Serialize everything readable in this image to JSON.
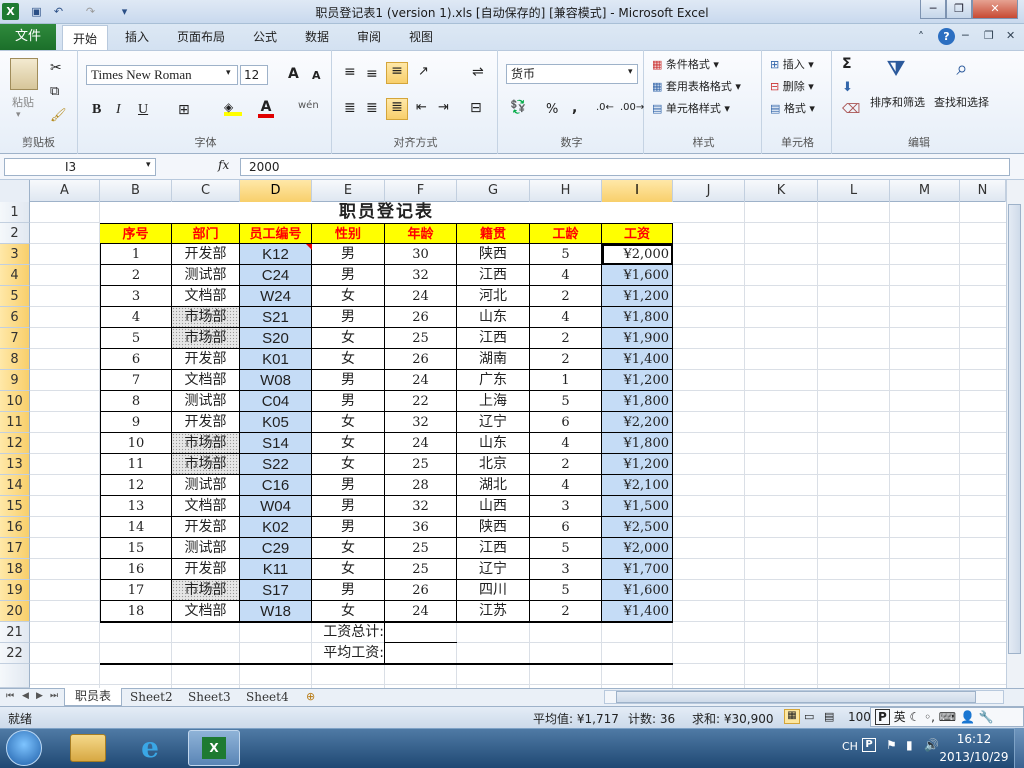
{
  "window": {
    "title": "职员登记表1 (version 1).xls [自动保存的] [兼容模式] - Microsoft Excel",
    "help_icon": "?",
    "app_icon": "X"
  },
  "ribbon_tabs": [
    "文件",
    "开始",
    "插入",
    "页面布局",
    "公式",
    "数据",
    "审阅",
    "视图"
  ],
  "ribbon": {
    "clipboard": {
      "paste": "粘贴",
      "label": "剪贴板"
    },
    "font": {
      "name": "Times New Roman",
      "size": "12",
      "label": "字体",
      "bold": "B",
      "italic": "I",
      "underline": "U",
      "grow": "A",
      "shrink": "A",
      "color_a": "A",
      "wen": "wén"
    },
    "align": {
      "label": "对齐方式"
    },
    "number": {
      "format": "货币",
      "percent": "%",
      "comma": ",",
      "label": "数字"
    },
    "styles": {
      "cond": "条件格式",
      "table": "套用表格格式",
      "cell": "单元格样式",
      "label": "样式"
    },
    "cells": {
      "insert": "插入",
      "delete": "删除",
      "format": "格式",
      "label": "单元格"
    },
    "edit": {
      "sum": "Σ",
      "sort": "排序和筛选",
      "find": "查找和选择",
      "label": "编辑"
    }
  },
  "formula_bar": {
    "name_box": "I3",
    "fx": "fx",
    "value": "2000"
  },
  "columns": [
    "A",
    "B",
    "C",
    "D",
    "E",
    "F",
    "G",
    "H",
    "I",
    "J",
    "K",
    "L",
    "M",
    "N"
  ],
  "sheet_title": "职员登记表",
  "headers": [
    "序号",
    "部门",
    "员工编号",
    "性别",
    "年龄",
    "籍贯",
    "工龄",
    "工资"
  ],
  "rows": [
    [
      "1",
      "开发部",
      "K12",
      "男",
      "30",
      "陕西",
      "5",
      "¥2,000"
    ],
    [
      "2",
      "测试部",
      "C24",
      "男",
      "32",
      "江西",
      "4",
      "¥1,600"
    ],
    [
      "3",
      "文档部",
      "W24",
      "女",
      "24",
      "河北",
      "2",
      "¥1,200"
    ],
    [
      "4",
      "市场部",
      "S21",
      "男",
      "26",
      "山东",
      "4",
      "¥1,800"
    ],
    [
      "5",
      "市场部",
      "S20",
      "女",
      "25",
      "江西",
      "2",
      "¥1,900"
    ],
    [
      "6",
      "开发部",
      "K01",
      "女",
      "26",
      "湖南",
      "2",
      "¥1,400"
    ],
    [
      "7",
      "文档部",
      "W08",
      "男",
      "24",
      "广东",
      "1",
      "¥1,200"
    ],
    [
      "8",
      "测试部",
      "C04",
      "男",
      "22",
      "上海",
      "5",
      "¥1,800"
    ],
    [
      "9",
      "开发部",
      "K05",
      "女",
      "32",
      "辽宁",
      "6",
      "¥2,200"
    ],
    [
      "10",
      "市场部",
      "S14",
      "女",
      "24",
      "山东",
      "4",
      "¥1,800"
    ],
    [
      "11",
      "市场部",
      "S22",
      "女",
      "25",
      "北京",
      "2",
      "¥1,200"
    ],
    [
      "12",
      "测试部",
      "C16",
      "男",
      "28",
      "湖北",
      "4",
      "¥2,100"
    ],
    [
      "13",
      "文档部",
      "W04",
      "男",
      "32",
      "山西",
      "3",
      "¥1,500"
    ],
    [
      "14",
      "开发部",
      "K02",
      "男",
      "36",
      "陕西",
      "6",
      "¥2,500"
    ],
    [
      "15",
      "测试部",
      "C29",
      "女",
      "25",
      "江西",
      "5",
      "¥2,000"
    ],
    [
      "16",
      "开发部",
      "K11",
      "女",
      "25",
      "辽宁",
      "3",
      "¥1,700"
    ],
    [
      "17",
      "市场部",
      "S17",
      "男",
      "26",
      "四川",
      "5",
      "¥1,600"
    ],
    [
      "18",
      "文档部",
      "W18",
      "女",
      "24",
      "江苏",
      "2",
      "¥1,400"
    ]
  ],
  "summary": {
    "total_label": "工资总计:",
    "avg_label": "平均工资:"
  },
  "sheet_tabs": [
    "职员表",
    "Sheet2",
    "Sheet3",
    "Sheet4"
  ],
  "status": {
    "ready": "就绪",
    "average": "平均值: ¥1,717",
    "count": "计数: 36",
    "sum": "求和: ¥30,900",
    "zoom": "100",
    "ime": "英"
  },
  "taskbar": {
    "lang": "CH",
    "time": "16:12",
    "date": "2013/10/29"
  }
}
